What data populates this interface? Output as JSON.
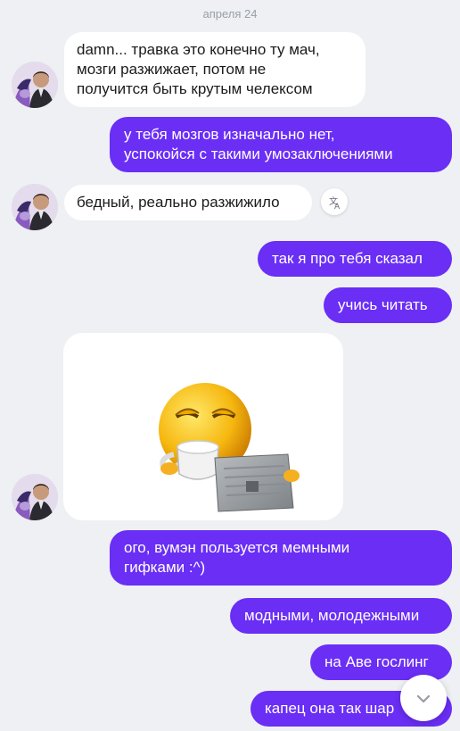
{
  "date_separator": "апреля 24",
  "messages": [
    {
      "text": "damn... травка это конечно ту мач,\nмозги разжижает, потом не\nполучится быть крутым челексом"
    },
    {
      "text": "у тебя мозгов изначально нет,\nуспокойся с такими умозаключениями"
    },
    {
      "text": "бедный, реально разжижило"
    },
    {
      "text": "так я про тебя сказал"
    },
    {
      "text": "учись читать"
    },
    {
      "text": "ого, вумэн пользуется мемными\nгифками :^)"
    },
    {
      "text": "модными, молодежными"
    },
    {
      "text": "на Аве гослинг"
    },
    {
      "text": "капец она так шар"
    }
  ],
  "icons": {
    "translate": "translate-icon",
    "scroll_down": "chevron-down-icon",
    "avatar": "avatar"
  },
  "colors": {
    "outgoing_bubble": "#6a2ef5",
    "incoming_bubble": "#ffffff",
    "background": "#eef0f3"
  }
}
